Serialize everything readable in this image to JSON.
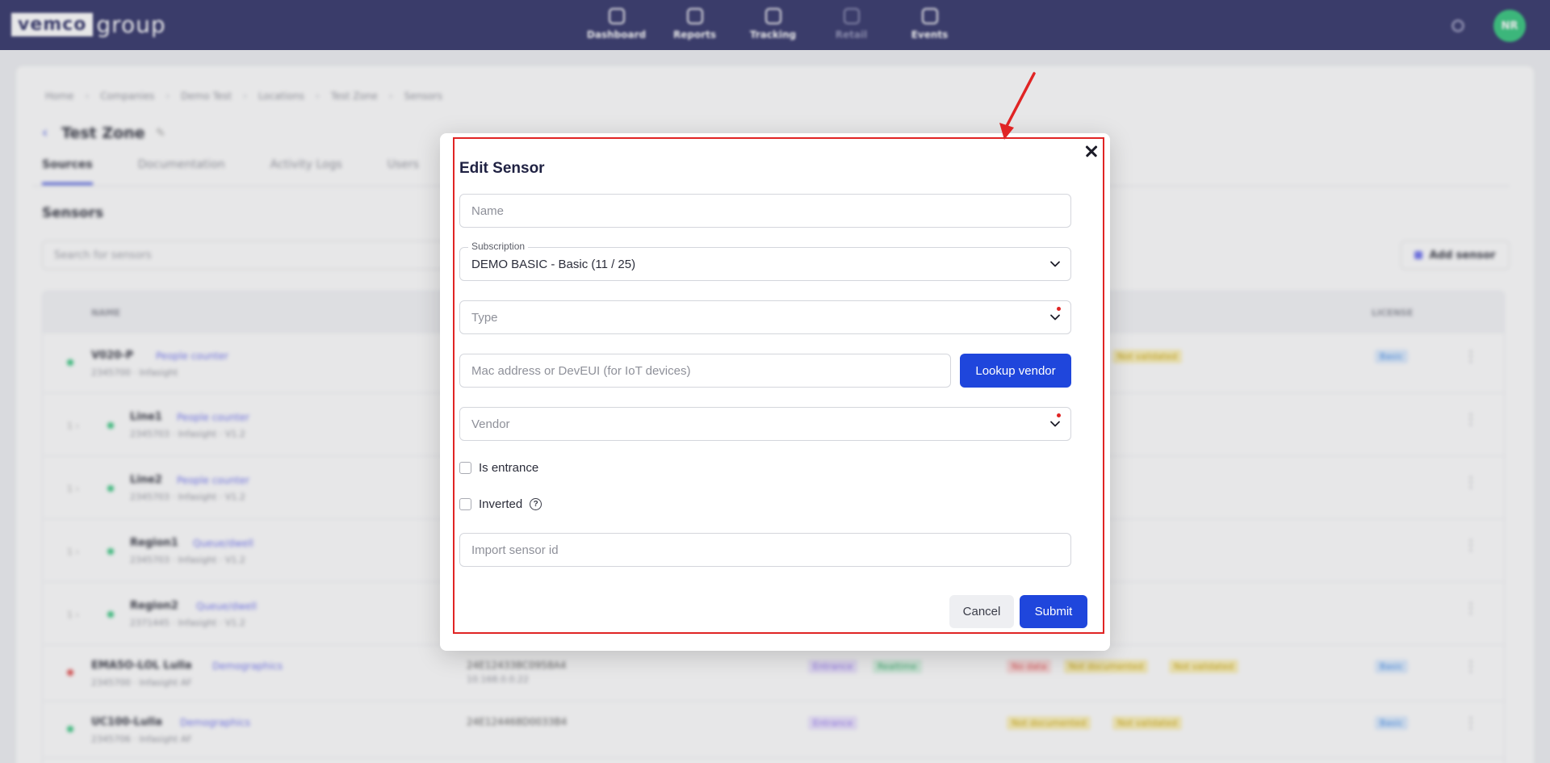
{
  "header": {
    "logo_box": "vemco",
    "logo_text": "group",
    "nav": [
      {
        "label": "Dashboard"
      },
      {
        "label": "Reports"
      },
      {
        "label": "Tracking"
      },
      {
        "label": "Retail"
      },
      {
        "label": "Events"
      }
    ],
    "avatar_initials": "NR"
  },
  "background": {
    "breadcrumbs": [
      "Home",
      "Companies",
      "Demo Test",
      "Locations",
      "Test Zone",
      "Sensors"
    ],
    "page_title": "Test Zone",
    "tabs": [
      "Sources",
      "Documentation",
      "Activity Logs",
      "Users"
    ],
    "section_title": "Sensors",
    "search_placeholder": "Search for sensors",
    "add_sensor_label": "Add sensor",
    "columns": {
      "name": "NAME",
      "license": "LICENSE"
    },
    "rows": [
      {
        "name": "V020-P",
        "type": "People counter",
        "sub": "2345700 · Infasight",
        "badge": "Not validated",
        "license": "Basic"
      },
      {
        "name": "Line1",
        "type": "People counter",
        "sub": "2345703 · Infasight · V1.2",
        "expander": "1 ›"
      },
      {
        "name": "Line2",
        "type": "People counter",
        "sub": "2345703 · Infasight · V1.2",
        "expander": "1 ›"
      },
      {
        "name": "Region1",
        "type": "Queue/dwell",
        "sub": "2345703 · Infasight · V1.2",
        "expander": "1 ›"
      },
      {
        "name": "Region2",
        "type": "Queue/dwell",
        "sub": "2371445 · Infasight · V1.2",
        "expander": "1 ›"
      },
      {
        "name": "EMA5O-LOL Lulla",
        "type": "Demographics",
        "sub": "2345700 · Infasight AF",
        "mid": "24E124338C0958A4",
        "mid2": "10.168.0.0.22",
        "badges": [
          "Entrance",
          "Realtime",
          "No data",
          "Not documented",
          "Not validated"
        ],
        "license": "Basic"
      },
      {
        "name": "UC100-Lulla",
        "type": "Demographics",
        "sub": "2345706 · Infasight AF",
        "mid": "24E124468D0033B4",
        "badges": [
          "Entrance",
          "Not documented",
          "Not validated"
        ],
        "license": "Basic"
      }
    ]
  },
  "modal": {
    "title": "Edit Sensor",
    "name_placeholder": "Name",
    "subscription_label": "Subscription",
    "subscription_value": "DEMO BASIC - Basic (11 / 25)",
    "type_placeholder": "Type",
    "mac_placeholder": "Mac address or DevEUI (for IoT devices)",
    "lookup_label": "Lookup vendor",
    "vendor_placeholder": "Vendor",
    "is_entrance_label": "Is entrance",
    "inverted_label": "Inverted",
    "help_glyph": "?",
    "import_placeholder": "Import sensor id",
    "cancel_label": "Cancel",
    "submit_label": "Submit"
  },
  "colors": {
    "header_bg": "#2d2f66",
    "primary": "#1f46dc",
    "highlight": "#e02424",
    "avatar": "#2fc47a"
  }
}
